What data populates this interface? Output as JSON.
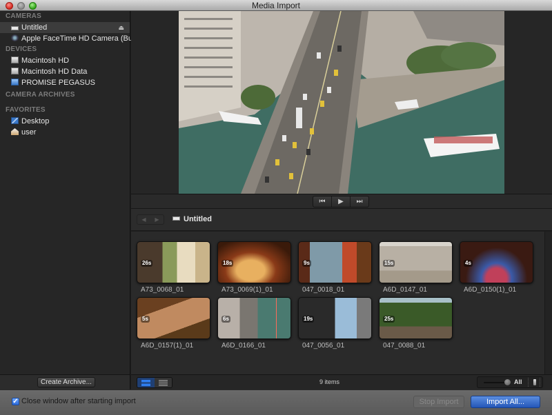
{
  "window": {
    "title": "Media Import"
  },
  "sidebar": {
    "sections": [
      {
        "header": "CAMERAS",
        "items": [
          {
            "label": "Untitled",
            "icon": "sd-card-icon",
            "selected": true,
            "eject": true
          },
          {
            "label": "Apple FaceTime HD Camera (Built-in)",
            "icon": "webcam-icon"
          }
        ]
      },
      {
        "header": "DEVICES",
        "items": [
          {
            "label": "Macintosh HD",
            "icon": "hard-drive-icon"
          },
          {
            "label": "Macintosh HD Data",
            "icon": "hard-drive-icon"
          },
          {
            "label": "PROMISE PEGASUS",
            "icon": "raid-drive-icon"
          }
        ]
      },
      {
        "header": "CAMERA ARCHIVES",
        "items": []
      },
      {
        "header": "FAVORITES",
        "items": [
          {
            "label": "Desktop",
            "icon": "desktop-folder-icon"
          },
          {
            "label": "user",
            "icon": "home-icon"
          }
        ]
      }
    ],
    "create_archive_label": "Create Archive..."
  },
  "viewer": {
    "transport": {
      "prev_icon": "⏮",
      "play_icon": "▶",
      "next_icon": "⏭"
    }
  },
  "browser": {
    "breadcrumb": "Untitled",
    "back_icon": "◀",
    "forward_icon": "▶",
    "clips": [
      {
        "name": "A73_0068_01",
        "duration": "26s"
      },
      {
        "name": "A73_0069(1)_01",
        "duration": "18s"
      },
      {
        "name": "047_0018_01",
        "duration": "9s"
      },
      {
        "name": "A6D_0147_01",
        "duration": "15s"
      },
      {
        "name": "A6D_0150(1)_01",
        "duration": "4s"
      },
      {
        "name": "A6D_0157(1)_01",
        "duration": "5s"
      },
      {
        "name": "A6D_0166_01",
        "duration": "6s"
      },
      {
        "name": "047_0056_01",
        "duration": "19s"
      },
      {
        "name": "047_0088_01",
        "duration": "25s"
      }
    ],
    "items_count": "9 items",
    "zoom_label": "All",
    "zoom_level": 1.0
  },
  "bottom": {
    "close_window_label": "Close window after starting import",
    "close_window_checked": true,
    "stop_import_label": "Stop Import",
    "import_all_label": "Import All..."
  },
  "colors": {
    "accent_blue": "#2456b8",
    "sidebar_bg": "#262626",
    "close": "#d2261d",
    "maximize": "#2fa317"
  }
}
